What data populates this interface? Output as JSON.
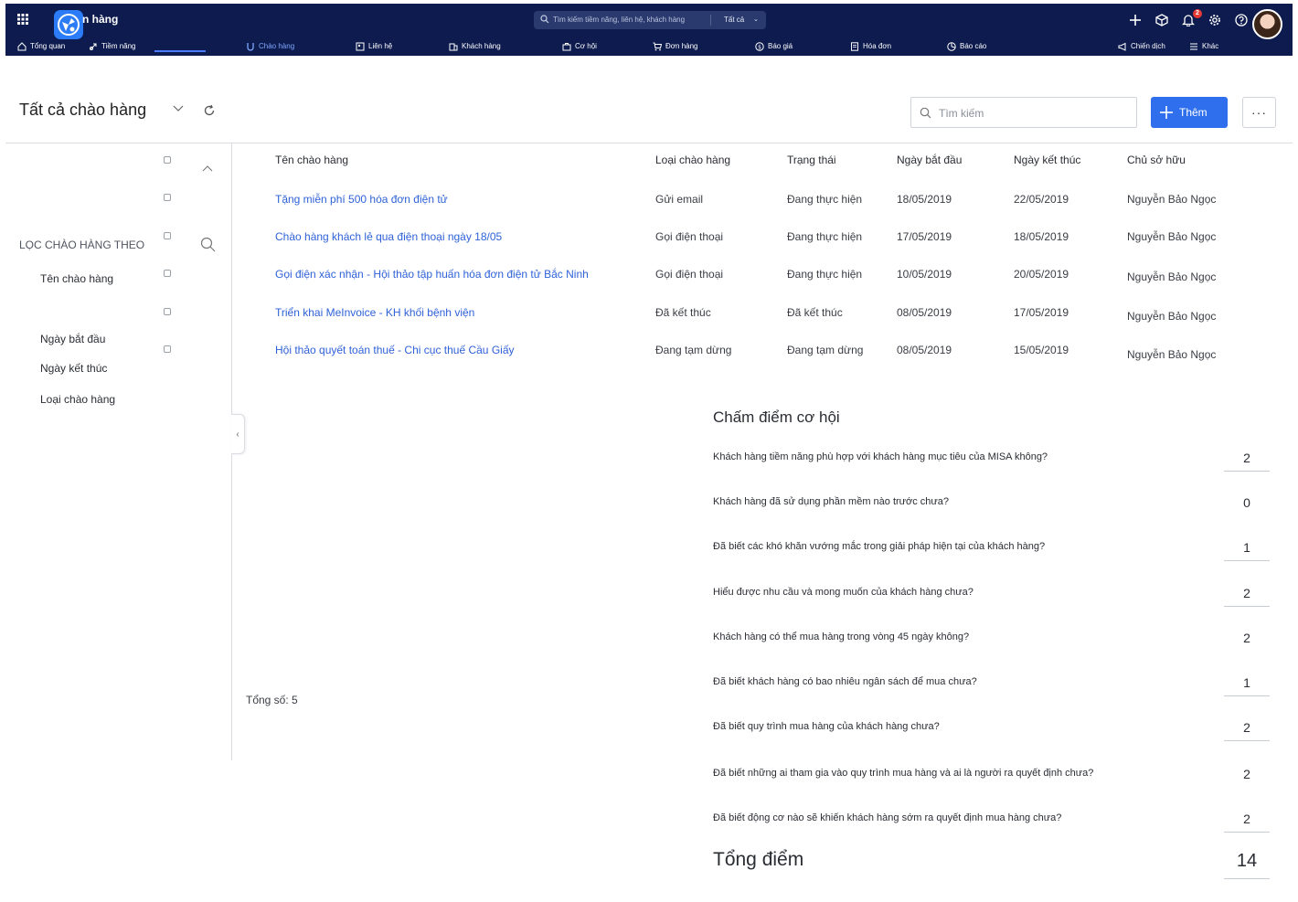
{
  "app": {
    "title": "n hàng",
    "search_placeholder": "Tìm kiếm tiềm năng, liên hệ, khách hàng",
    "search_scope": "Tất cả",
    "notification_count": "2",
    "accent_color": "#2f6fed",
    "header_bg": "#0d1b4e"
  },
  "nav": {
    "overview": "Tổng quan",
    "leads": "Tiềm năng",
    "offers": "Chào hàng",
    "contacts": "Liên hệ",
    "customers": "Khách hàng",
    "opportunities": "Cơ hội",
    "orders": "Đơn hàng",
    "quotes": "Báo giá",
    "invoices": "Hóa đơn",
    "reports": "Báo cáo",
    "campaigns": "Chiến dịch",
    "more": "Khác"
  },
  "page": {
    "title": "Tất cả chào hàng",
    "search_placeholder": "Tìm kiếm",
    "add_label": "Thêm",
    "more_label": "···"
  },
  "filter": {
    "title": "LỌC CHÀO HÀNG THEO",
    "items": [
      "Tên chào hàng",
      "Ngày bắt đầu",
      "Ngày kết thúc",
      "Loại chào hàng"
    ]
  },
  "table": {
    "headers": [
      "Tên chào hàng",
      "Loại chào hàng",
      "Trạng thái",
      "Ngày bắt đầu",
      "Ngày kết thúc",
      "Chủ sở hữu"
    ],
    "rows": [
      {
        "name": "Tặng miễn phí 500 hóa đơn điện tử",
        "type": "Gửi email",
        "status": "Đang thực hiện",
        "start": "18/05/2019",
        "end": "22/05/2019",
        "owner": "Nguyễn Bảo Ngọc"
      },
      {
        "name": "Chào hàng khách lẻ qua điện thoại ngày 18/05",
        "type": "Gọi điện thoại",
        "status": "Đang thực hiện",
        "start": "17/05/2019",
        "end": "18/05/2019",
        "owner": "Nguyễn Bảo Ngọc"
      },
      {
        "name": "Gọi điện xác nhận - Hội thảo tập huấn hóa đơn điện tử Bắc Ninh",
        "type": "Gọi điện thoại",
        "status": "Đang thực hiện",
        "start": "10/05/2019",
        "end": "20/05/2019",
        "owner": "Nguyễn Bảo Ngọc"
      },
      {
        "name": "Triển khai MeInvoice - KH khối bệnh viện",
        "type": "Đã kết thúc",
        "status": "Đã kết thúc",
        "start": "08/05/2019",
        "end": "17/05/2019",
        "owner": "Nguyễn Bảo Ngọc"
      },
      {
        "name": "Hội thảo quyết toán thuế - Chi cục thuế Cầu Giấy",
        "type": "Đang tạm dừng",
        "status": "Đang tạm dừng",
        "start": "08/05/2019",
        "end": "15/05/2019",
        "owner": "Nguyễn Bảo Ngọc"
      }
    ],
    "total_label": "Tổng số: 5"
  },
  "scoring": {
    "title": "Chấm điểm cơ hội",
    "questions": [
      {
        "text": "Khách hàng tiềm năng phù hợp với khách hàng mục tiêu của MISA không?",
        "score": "2"
      },
      {
        "text": "Khách hàng đã sử dụng phần mềm nào trước chưa?",
        "score": "0"
      },
      {
        "text": "Đã biết các khó khăn vướng mắc trong giải pháp hiện tại của khách hàng?",
        "score": "1"
      },
      {
        "text": "Hiểu được nhu cầu và mong muốn của khách hàng chưa?",
        "score": "2"
      },
      {
        "text": "Khách hàng có thể mua hàng trong vòng 45 ngày không?",
        "score": "2"
      },
      {
        "text": "Đã biết khách hàng có bao nhiêu ngân sách để mua chưa?",
        "score": "1"
      },
      {
        "text": "Đã biết quy trình mua hàng của khách hàng chưa?",
        "score": "2"
      },
      {
        "text": "Đã biết những ai tham gia vào quy trình mua hàng và ai là người ra quyết định chưa?",
        "score": "2"
      },
      {
        "text": "Đã biết động cơ nào sẽ khiến khách hàng sớm ra quyết định mua hàng chưa?",
        "score": "2"
      }
    ],
    "total_label": "Tổng điểm",
    "total_score": "14"
  }
}
